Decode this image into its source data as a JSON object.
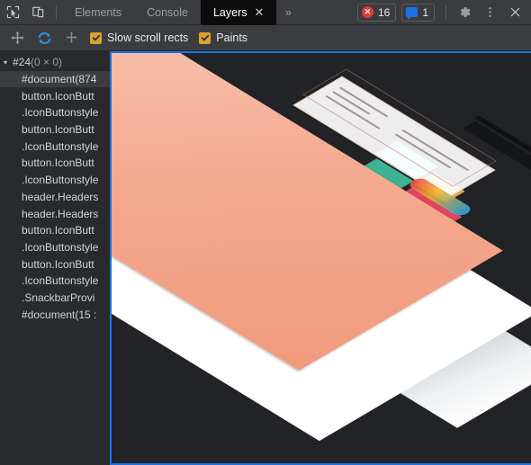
{
  "toolbar": {
    "inspect_icon": "inspect-cursor-icon",
    "device_icon": "device-toolbar-icon",
    "tabs": [
      {
        "label": "Elements",
        "active": false,
        "closable": false
      },
      {
        "label": "Console",
        "active": false,
        "closable": false
      },
      {
        "label": "Layers",
        "active": true,
        "closable": true
      }
    ],
    "tab_close_glyph": "✕",
    "more_tabs_glyph": "»",
    "error_badge": {
      "icon": "error-circle-icon",
      "glyph": "✕",
      "count": "16"
    },
    "message_badge": {
      "icon": "message-bubble-icon",
      "count": "1"
    },
    "settings_icon": "gear-icon",
    "menu_icon": "kebab-menu-icon",
    "close_icon": "close-icon"
  },
  "layers_controls": {
    "pan_icon": "pan-mode-icon",
    "rotate_icon": "rotate-mode-icon",
    "reset_icon": "reset-transform-icon",
    "checkboxes": [
      {
        "label": "Slow scroll rects",
        "checked": true
      },
      {
        "label": "Paints",
        "checked": true
      }
    ],
    "check_glyph": "✓"
  },
  "sidebar": {
    "root": {
      "twisty": "▾",
      "name": "#24",
      "detail": "(0 × 0)"
    },
    "items": [
      {
        "label": "#document(874",
        "selected": true
      },
      {
        "label": "button.IconButt",
        "selected": false
      },
      {
        "label": ".IconButtonstyle",
        "selected": false
      },
      {
        "label": "button.IconButt",
        "selected": false
      },
      {
        "label": ".IconButtonstyle",
        "selected": false
      },
      {
        "label": "button.IconButt",
        "selected": false
      },
      {
        "label": ".IconButtonstyle",
        "selected": false
      },
      {
        "label": "header.Headers",
        "selected": false
      },
      {
        "label": "header.Headers",
        "selected": false
      },
      {
        "label": "button.IconButt",
        "selected": false
      },
      {
        "label": ".IconButtonstyle",
        "selected": false
      },
      {
        "label": "button.IconButt",
        "selected": false
      },
      {
        "label": ".IconButtonstyle",
        "selected": false
      },
      {
        "label": ".SnackbarProvi",
        "selected": false
      },
      {
        "label": "#document(15 :",
        "selected": false
      }
    ]
  },
  "viewport": {
    "name": "layers-3d-viewport",
    "focus_color": "#1a73e8",
    "background_color": "#222326",
    "layer_colors": {
      "page_layer": "#f4a98f",
      "content_layer": "#ffffff",
      "dark_strip": "#141517"
    }
  }
}
